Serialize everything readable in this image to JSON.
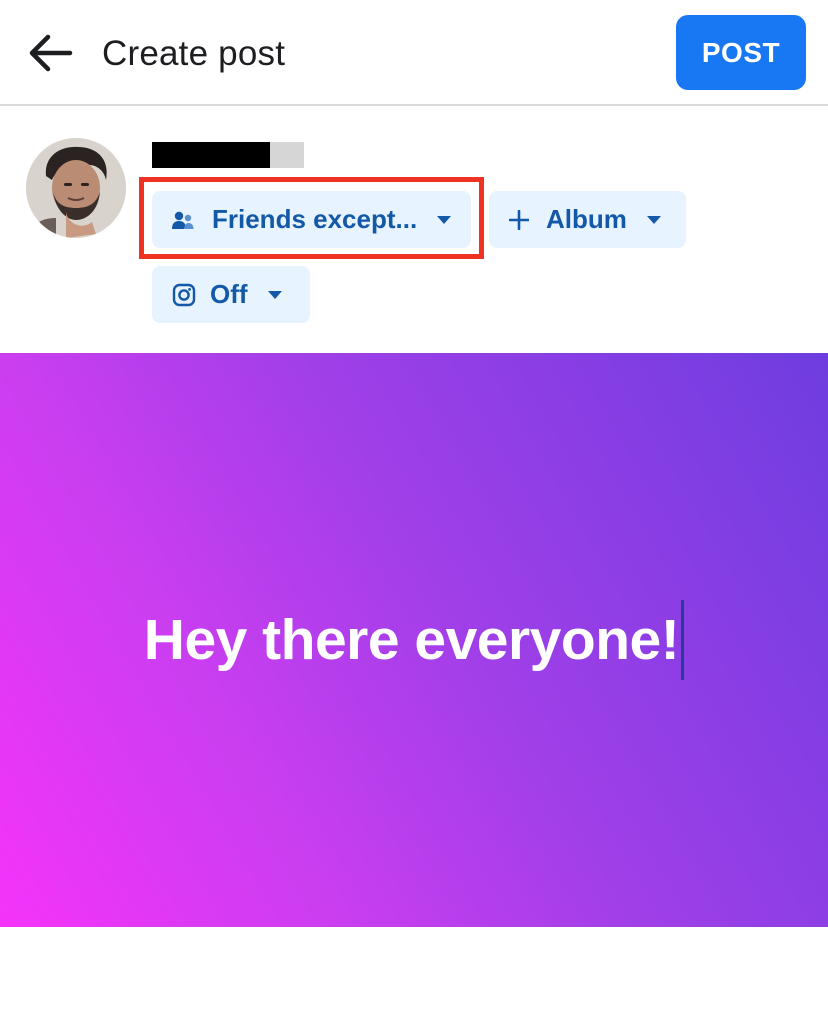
{
  "header": {
    "title": "Create post",
    "back_icon": "arrow-left-icon",
    "post_label": "POST"
  },
  "composer": {
    "audience": {
      "label": "Friends except...",
      "icon": "people-icon"
    },
    "album": {
      "label": "Album",
      "icon": "plus-icon"
    },
    "instagram": {
      "label": "Off",
      "icon": "instagram-icon"
    }
  },
  "canvas": {
    "text": "Hey there everyone!",
    "gradient": [
      "#f533fa",
      "#c93ef0",
      "#a03fe8",
      "#6e3ddf"
    ]
  },
  "colors": {
    "accent": "#1877f2",
    "chip_background": "#e7f3ff",
    "chip_text": "#1459a8",
    "highlight": "#ee3322"
  }
}
